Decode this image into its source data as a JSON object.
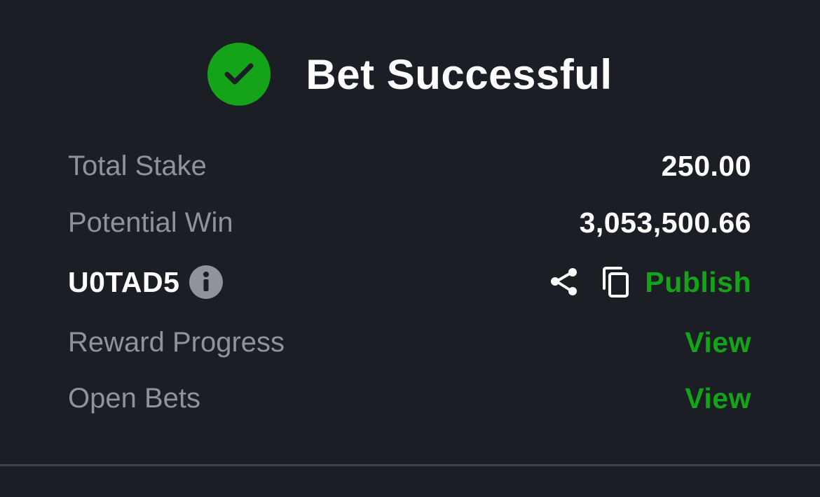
{
  "header": {
    "title": "Bet Successful",
    "icon": "check-circle-icon",
    "icon_color": "#14a319"
  },
  "summary": {
    "total_stake": {
      "label": "Total Stake",
      "value": "250.00"
    },
    "potential_win": {
      "label": "Potential Win",
      "value": "3,053,500.66"
    }
  },
  "booking": {
    "code": "U0TAD5",
    "info_icon": "info-icon",
    "share_icon": "share-icon",
    "copy_icon": "copy-icon",
    "publish_label": "Publish"
  },
  "links": {
    "reward_progress": {
      "label": "Reward Progress",
      "action": "View"
    },
    "open_bets": {
      "label": "Open Bets",
      "action": "View"
    }
  },
  "colors": {
    "background": "#1b1e24",
    "accent_green": "#14a319",
    "muted_text": "#8e939c",
    "divider": "#3f434a"
  }
}
